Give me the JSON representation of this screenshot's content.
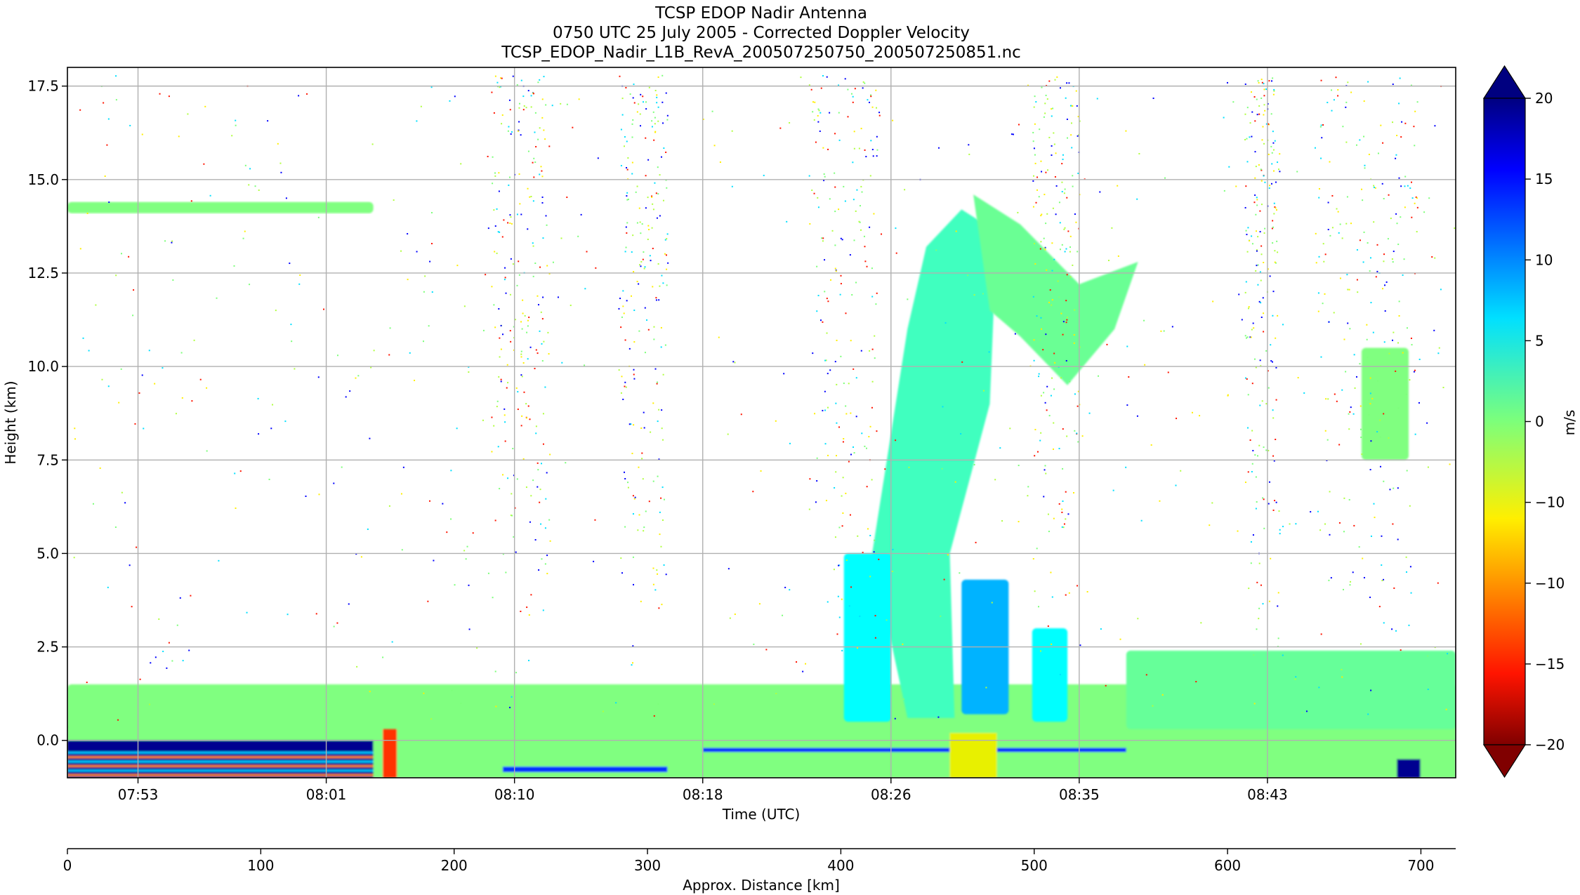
{
  "chart_data": {
    "type": "heatmap",
    "title": [
      "TCSP EDOP Nadir Antenna",
      "0750 UTC 25 July 2005 - Corrected Doppler Velocity",
      "TCSP_EDOP_Nadir_L1B_RevA_200507250750_200507250851.nc"
    ],
    "xlabel": "Time (UTC)",
    "ylabel": "Height (km)",
    "x_ticks": [
      "07:53",
      "08:01",
      "08:10",
      "08:18",
      "08:26",
      "08:35",
      "08:43"
    ],
    "x_tick_minutes": [
      3.0,
      11.0,
      19.0,
      27.0,
      35.0,
      43.0,
      51.0
    ],
    "x_range_minutes": [
      0,
      59
    ],
    "ylim": [
      -1.0,
      18.0
    ],
    "y_ticks": [
      0.0,
      2.5,
      5.0,
      7.5,
      10.0,
      12.5,
      15.0,
      17.5
    ],
    "y_tick_labels": [
      "0.0",
      "2.5",
      "5.0",
      "7.5",
      "10.0",
      "12.5",
      "15.0",
      "17.5"
    ],
    "grid": true,
    "secondary_axis": {
      "label": "Approx. Distance [km]",
      "range": [
        0,
        718
      ],
      "ticks": [
        0,
        100,
        200,
        300,
        400,
        500,
        600,
        700
      ],
      "tick_labels": [
        "0",
        "100",
        "200",
        "300",
        "400",
        "500",
        "600",
        "700"
      ]
    },
    "colorbar": {
      "label": "m/s",
      "range": [
        -20,
        20
      ],
      "ticks": [
        20,
        15,
        10,
        5,
        0,
        -5,
        -10,
        -15,
        -20
      ],
      "tick_labels": [
        "20",
        "15",
        "10",
        "5",
        "0",
        "−10",
        "−10",
        "−15",
        "−20"
      ],
      "colormap": "jet",
      "extend": "both"
    },
    "data_gaps_minutes": [
      [
        25.5,
        27.0
      ]
    ],
    "features": [
      {
        "kind": "surface return",
        "t_min": [
          0,
          59
        ],
        "z_km": [
          -1.0,
          0.5
        ],
        "velocity": 0
      },
      {
        "kind": "low cloud layer",
        "t_min": [
          0,
          59
        ],
        "z_km": [
          0.3,
          1.5
        ],
        "velocity": 0
      },
      {
        "kind": "upper layer",
        "t_min": [
          0,
          13
        ],
        "z_km": [
          14.1,
          14.4
        ],
        "velocity": 0
      },
      {
        "kind": "convective core",
        "t_min": [
          34,
          40.5
        ],
        "z_km": [
          0.5,
          14.5
        ],
        "velocity": 3
      },
      {
        "kind": "updraft",
        "t_min": [
          38,
          40
        ],
        "z_km": [
          0.7,
          4.3
        ],
        "velocity": 8
      },
      {
        "kind": "anvil",
        "t_min": [
          39,
          46
        ],
        "z_km": [
          9.5,
          14.0
        ],
        "velocity": 1
      },
      {
        "kind": "shallow convection",
        "t_min": [
          33,
          35
        ],
        "z_km": [
          0.5,
          5.0
        ],
        "velocity": 5
      },
      {
        "kind": "shallow convection",
        "t_min": [
          41,
          42.5
        ],
        "z_km": [
          0.5,
          3.0
        ],
        "velocity": 5
      },
      {
        "kind": "rising cloud tops",
        "t_min": [
          45,
          59
        ],
        "z_km": [
          0.3,
          2.4
        ],
        "velocity": 1
      },
      {
        "kind": "high cloud",
        "t_min": [
          55,
          57
        ],
        "z_km": [
          7.5,
          10.5
        ],
        "velocity": 0
      }
    ]
  }
}
